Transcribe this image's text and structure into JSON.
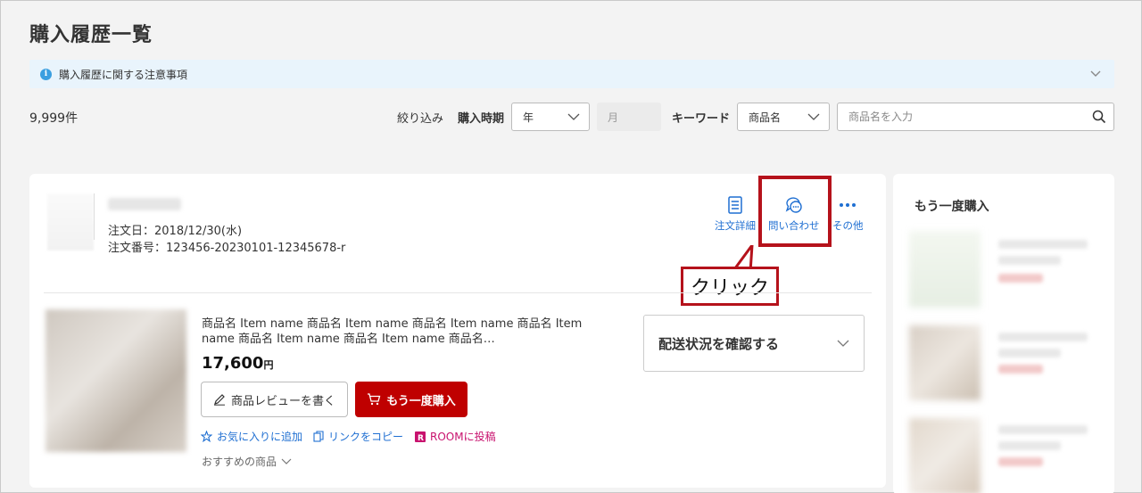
{
  "page": {
    "title": "購入履歴一覧"
  },
  "notice": {
    "text": "購入履歴に関する注意事項"
  },
  "results": {
    "count": "9,999件"
  },
  "filters": {
    "label": "絞り込み",
    "period_label": "購入時期",
    "year_value": "年",
    "month_placeholder": "月",
    "keyword_label": "キーワード",
    "keyword_type": "商品名",
    "search_placeholder": "商品名を入力"
  },
  "order": {
    "date": "注文日：2018/12/30(水)",
    "number": "注文番号：123456-20230101-12345678-r",
    "actions": {
      "detail": "注文詳細",
      "inquiry": "問い合わせ",
      "other": "その他"
    },
    "product": {
      "name": "商品名 Item name 商品名 Item name 商品名 Item name 商品名 Item name 商品名 Item name 商品名 Item name 商品名…",
      "price": "17,600",
      "currency": "円"
    },
    "buttons": {
      "review": "商品レビューを書く",
      "rebuy": "もう一度購入"
    },
    "links": {
      "favorite": "お気に入りに追加",
      "copy": "リンクをコピー",
      "room": "ROOMに投稿"
    },
    "recommend": "おすすめの商品",
    "shipping": "配送状況を確認する"
  },
  "annotation": {
    "callout": "クリック"
  },
  "sidebar": {
    "title": "もう一度購入"
  },
  "colors": {
    "accent_red": "#bf0000",
    "link_blue": "#1f6fd2",
    "highlight": "#b5121b",
    "room_pink": "#c8126e"
  }
}
